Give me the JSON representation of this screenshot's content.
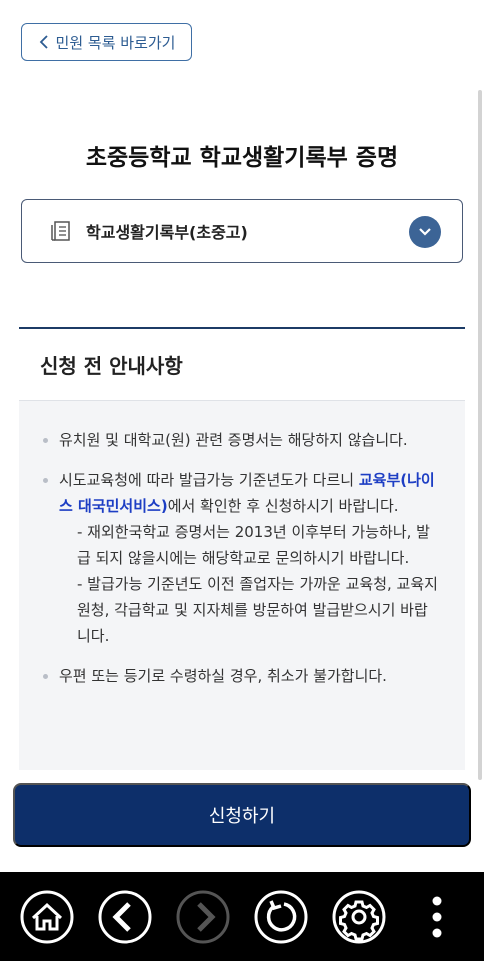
{
  "header": {
    "back_label": "민원 목록 바로가기"
  },
  "page": {
    "title": "초중등학교 학교생활기록부 증명"
  },
  "selector": {
    "selected_value": "학교생활기록부(초중고)"
  },
  "notice": {
    "title": "신청 전 안내사항",
    "item1": "유치원 및 대학교(원) 관련 증명서는 해당하지 않습니다.",
    "item2_prefix": "시도교육청에 따라 발급가능 기준년도가 다르니 ",
    "item2_link": "교육부(나이스 대국민서비스)",
    "item2_suffix": "에서 확인한 후 신청하시기 바랍니다.",
    "sub1": "- 재외한국학교 증명서는 2013년 이후부터 가능하나, 발급 되지 않을시에는 해당학교로 문의하시기 바랍니다.",
    "sub2": "- 발급가능 기준년도 이전 졸업자는 가까운 교육청, 교육지원청, 각급학교 및 지자체를 방문하여 발급받으시기 바랍니다.",
    "item3": "우편 또는 등기로 수령하실 경우, 취소가 불가합니다."
  },
  "actions": {
    "apply_label": "신청하기"
  },
  "colors": {
    "primary": "#0d2f6a",
    "accent": "#3c6496",
    "link": "#1d3ec4"
  },
  "icons": {
    "back": "chevron-left-icon",
    "document": "document-icon",
    "dropdown": "chevron-down-icon",
    "home": "home-icon",
    "prev": "arrow-left-icon",
    "next": "arrow-right-icon",
    "refresh": "refresh-icon",
    "settings": "gear-icon",
    "more": "more-vertical-icon"
  }
}
